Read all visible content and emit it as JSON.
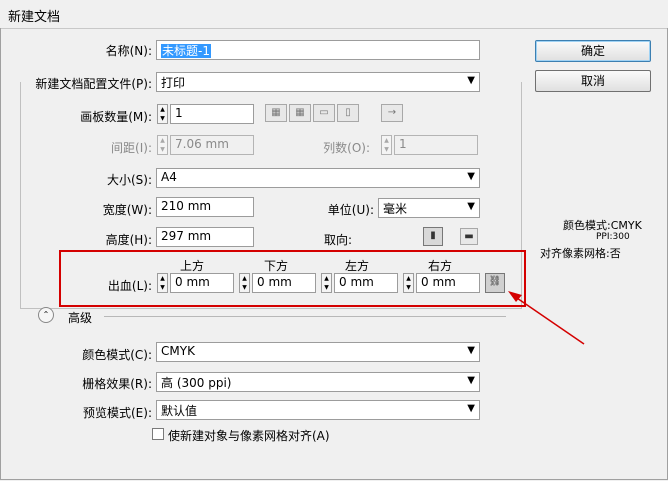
{
  "window": {
    "title": "新建文档"
  },
  "form": {
    "name_label": "名称(N):",
    "name_value": "未标题-1",
    "profile_label": "新建文档配置文件(P):",
    "profile_value": "打印",
    "artboards_label": "画板数量(M):",
    "artboards_value": "1",
    "spacing_label": "间距(I):",
    "spacing_value": "7.06 mm",
    "columns_label": "列数(O):",
    "columns_value": "1",
    "size_label": "大小(S):",
    "size_value": "A4",
    "width_label": "宽度(W):",
    "width_value": "210 mm",
    "units_label": "单位(U):",
    "units_value": "毫米",
    "height_label": "高度(H):",
    "height_value": "297 mm",
    "orientation_label": "取向:"
  },
  "bleed": {
    "label": "出血(L):",
    "top_label": "上方",
    "top_value": "0 mm",
    "bottom_label": "下方",
    "bottom_value": "0 mm",
    "left_label": "左方",
    "left_value": "0 mm",
    "right_label": "右方",
    "right_value": "0 mm"
  },
  "advanced": {
    "label": "高级",
    "color_mode_label": "颜色模式(C):",
    "color_mode_value": "CMYK",
    "raster_label": "栅格效果(R):",
    "raster_value": "高 (300 ppi)",
    "preview_label": "预览模式(E):",
    "preview_value": "默认值",
    "align_checkbox_label": "使新建对象与像素网格对齐(A)",
    "align_checked": false
  },
  "buttons": {
    "ok": "确定",
    "cancel": "取消"
  },
  "info": {
    "color_mode": "颜色模式:CMYK",
    "ppi": "PPI:300",
    "align_grid": "对齐像素网格:否"
  },
  "colors": {
    "highlight": "#d40000",
    "selection": "#3399ff"
  }
}
